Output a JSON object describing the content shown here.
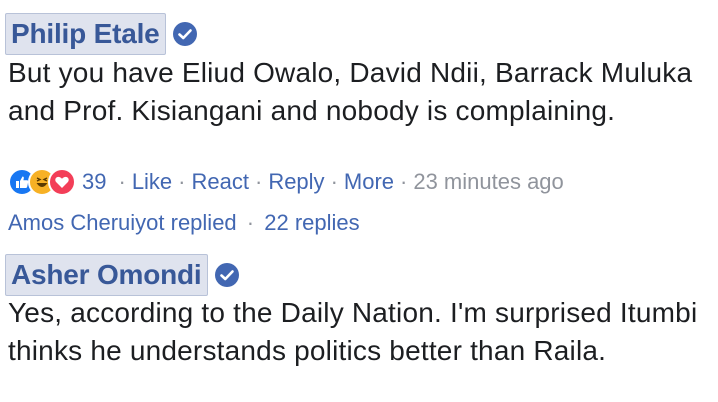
{
  "comments": [
    {
      "author": "Philip Etale",
      "text": "But you have Eliud Owalo, David Ndii, Barrack Muluka and Prof. Kisiangani and nobody is complaining.",
      "reaction_count": "39",
      "actions": {
        "like": "Like",
        "react": "React",
        "reply": "Reply",
        "more": "More"
      },
      "separator": "·",
      "timestamp": "23 minutes ago",
      "replies_line": {
        "replier": "Amos Cheruiyot replied",
        "separator": "·",
        "count": "22 replies"
      }
    },
    {
      "author": "Asher Omondi",
      "text": "Yes, according to the Daily Nation. I'm surprised Itumbi thinks he understands politics better than Raila."
    }
  ],
  "icons": {
    "verified": "verified-badge-icon",
    "reactions": [
      "like-reaction-icon",
      "haha-reaction-icon",
      "love-reaction-icon"
    ]
  },
  "colors": {
    "name_text": "#385898",
    "name_bg": "#dfe3ee",
    "link": "#4267b2",
    "meta": "#90949c",
    "body": "#1c1e21",
    "verified": "#4267b2",
    "like": "#1877f2",
    "haha": "#f7b125",
    "love": "#f33e58"
  }
}
